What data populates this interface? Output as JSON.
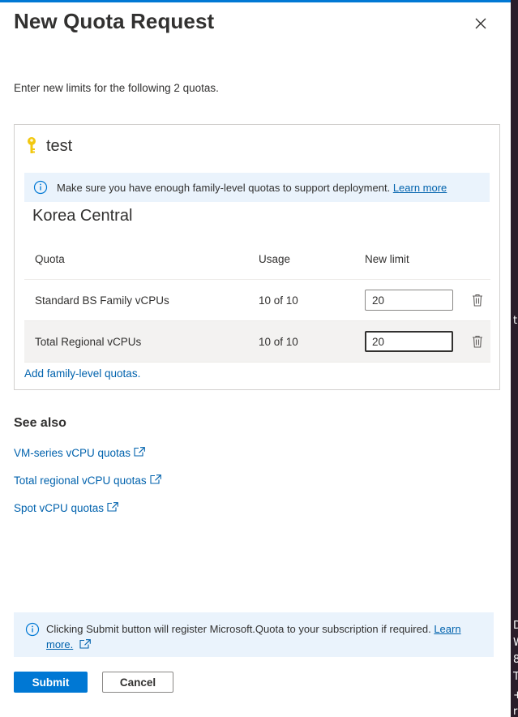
{
  "dialog": {
    "title": "New Quota Request",
    "intro": "Enter new limits for the following 2 quotas."
  },
  "subscription": {
    "name": "test",
    "info_message": "Make sure you have enough family-level quotas to support deployment.",
    "info_link": "Learn more",
    "region": "Korea Central"
  },
  "table": {
    "headers": {
      "quota": "Quota",
      "usage": "Usage",
      "new_limit": "New limit"
    },
    "rows": [
      {
        "quota": "Standard BS Family vCPUs",
        "usage": "10 of 10",
        "new_limit": "20"
      },
      {
        "quota": "Total Regional vCPUs",
        "usage": "10 of 10",
        "new_limit": "20"
      }
    ],
    "add_link": "Add family-level quotas."
  },
  "see_also": {
    "heading": "See also",
    "links": [
      "VM-series vCPU quotas",
      "Total regional vCPU quotas",
      "Spot vCPU quotas"
    ]
  },
  "notice": {
    "text": "Clicking Submit button will register Microsoft.Quota to your subscription if required.",
    "link_part1": "Learn",
    "link_part2": "more."
  },
  "buttons": {
    "submit": "Submit",
    "cancel": "Cancel"
  },
  "background_glyphs": [
    "t",
    "D",
    "W",
    "8",
    "T",
    "+",
    "r"
  ],
  "colors": {
    "accent": "#0078d4",
    "link": "#0062ad",
    "info_bg": "#eaf3fc",
    "key_icon": "#f2c811"
  }
}
